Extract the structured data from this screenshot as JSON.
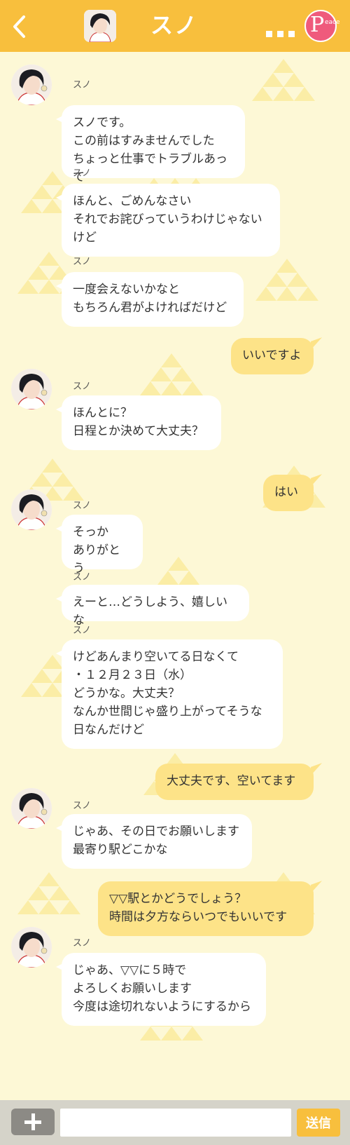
{
  "header": {
    "title": "スノ",
    "back_icon": "chevron-left-icon",
    "more_label": "...",
    "logo_letter": "P",
    "logo_text": "eace"
  },
  "colors": {
    "header_bg": "#f8bf3d",
    "background": "#fdf8d6",
    "incoming_bubble": "#ffffff",
    "outgoing_bubble": "#fde388",
    "logo": "#ef5a7c"
  },
  "messages": [
    {
      "dir": "in",
      "avatar": true,
      "sender": "スノ",
      "text": "スノです。\nこの前はすみませんでした\nちょっと仕事でトラブルあって"
    },
    {
      "dir": "in",
      "avatar": false,
      "sender": "スノ",
      "text": "ほんと、ごめんなさい\nそれでお詫びっていうわけじゃない\nけど"
    },
    {
      "dir": "in",
      "avatar": false,
      "sender": "スノ",
      "text": "一度会えないかなと\nもちろん君がよければだけど"
    },
    {
      "dir": "out",
      "text": "いいですよ"
    },
    {
      "dir": "in",
      "avatar": true,
      "sender": "スノ",
      "text": "ほんとに？\n日程とか決めて大丈夫？"
    },
    {
      "dir": "out",
      "text": "はい"
    },
    {
      "dir": "in",
      "avatar": true,
      "sender": "スノ",
      "text": "そっか\nありがとう"
    },
    {
      "dir": "in",
      "avatar": false,
      "sender": "スノ",
      "text": "えーと…どうしよう、嬉しいな"
    },
    {
      "dir": "in",
      "avatar": false,
      "sender": "スノ",
      "text": "けどあんまり空いてる日なくて\n・１２月２３日（水）\nどうかな。大丈夫？\nなんか世間じゃ盛り上がってそうな\n日なんだけど"
    },
    {
      "dir": "out",
      "text": "大丈夫です、空いてます"
    },
    {
      "dir": "in",
      "avatar": true,
      "sender": "スノ",
      "text": "じゃあ、その日でお願いします\n最寄り駅どこかな"
    },
    {
      "dir": "out",
      "text": "▽▽駅とかどうでしょう？\n時間は夕方ならいつでもいいです"
    },
    {
      "dir": "in",
      "avatar": true,
      "sender": "スノ",
      "text": "じゃあ、▽▽に５時で\nよろしくお願いします\n今度は途切れないようにするから"
    }
  ],
  "footer": {
    "plus_icon": "plus-icon",
    "input_value": "",
    "input_placeholder": "",
    "send_label": "送信"
  }
}
